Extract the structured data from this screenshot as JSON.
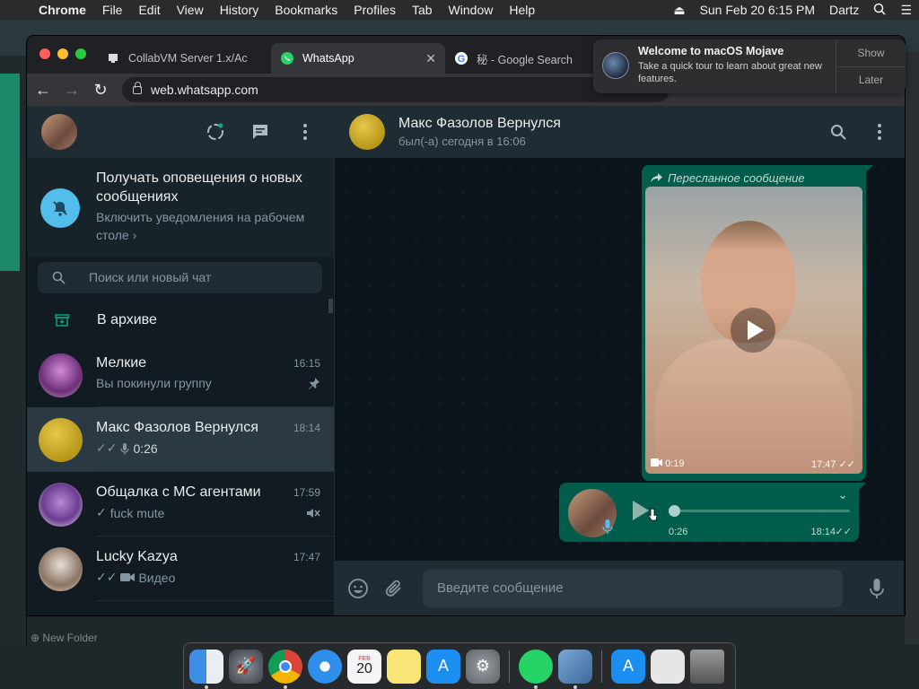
{
  "menubar": {
    "items": [
      "Chrome",
      "File",
      "Edit",
      "View",
      "History",
      "Bookmarks",
      "Profiles",
      "Tab",
      "Window",
      "Help"
    ],
    "datetime": "Sun Feb 20  6:15 PM",
    "user": "Dartz"
  },
  "browser": {
    "tabs": [
      {
        "title": "CollabVM Server 1.x/Ac"
      },
      {
        "title": "WhatsApp"
      },
      {
        "title": "秘 - Google Search"
      }
    ],
    "url": "web.whatsapp.com"
  },
  "notification": {
    "title": "Welcome to macOS Mojave",
    "subtitle": "Take a quick tour to learn about great new features.",
    "show": "Show",
    "later": "Later"
  },
  "sidebar": {
    "notify_title": "Получать оповещения о новых сообщениях",
    "notify_sub": "Включить уведомления на рабочем столе",
    "search_placeholder": "Поиск или новый чат",
    "archive": "В архиве",
    "chats": [
      {
        "name": "Мелкие",
        "time": "16:15",
        "preview": "Вы покинули группу",
        "icon": "pin-icon"
      },
      {
        "name": "Макс Фазолов Вернулся",
        "time": "18:14",
        "preview": "0:26",
        "icon": "mic-icon"
      },
      {
        "name": "Общалка с МС агентами",
        "time": "17:59",
        "preview": "fuck mute",
        "icon": "muted-icon"
      },
      {
        "name": "Lucky Kazya",
        "time": "17:47",
        "preview": "Видео",
        "icon": "video-icon"
      }
    ]
  },
  "conversation": {
    "name": "Макс Фазолов Вернулся",
    "status": "был(-а) сегодня в 16:06",
    "forwarded": "Пересланное сообщение",
    "video_duration": "0:19",
    "video_time": "17:47",
    "voice_duration": "0:26",
    "voice_time": "18:14",
    "compose_placeholder": "Введите сообщение"
  },
  "desktop": {
    "folder_label": "New Folder"
  },
  "colors": {
    "accent_green": "#005c4b",
    "panel": "#202c33",
    "background": "#111b21",
    "notify_blue": "#53bdeb"
  }
}
